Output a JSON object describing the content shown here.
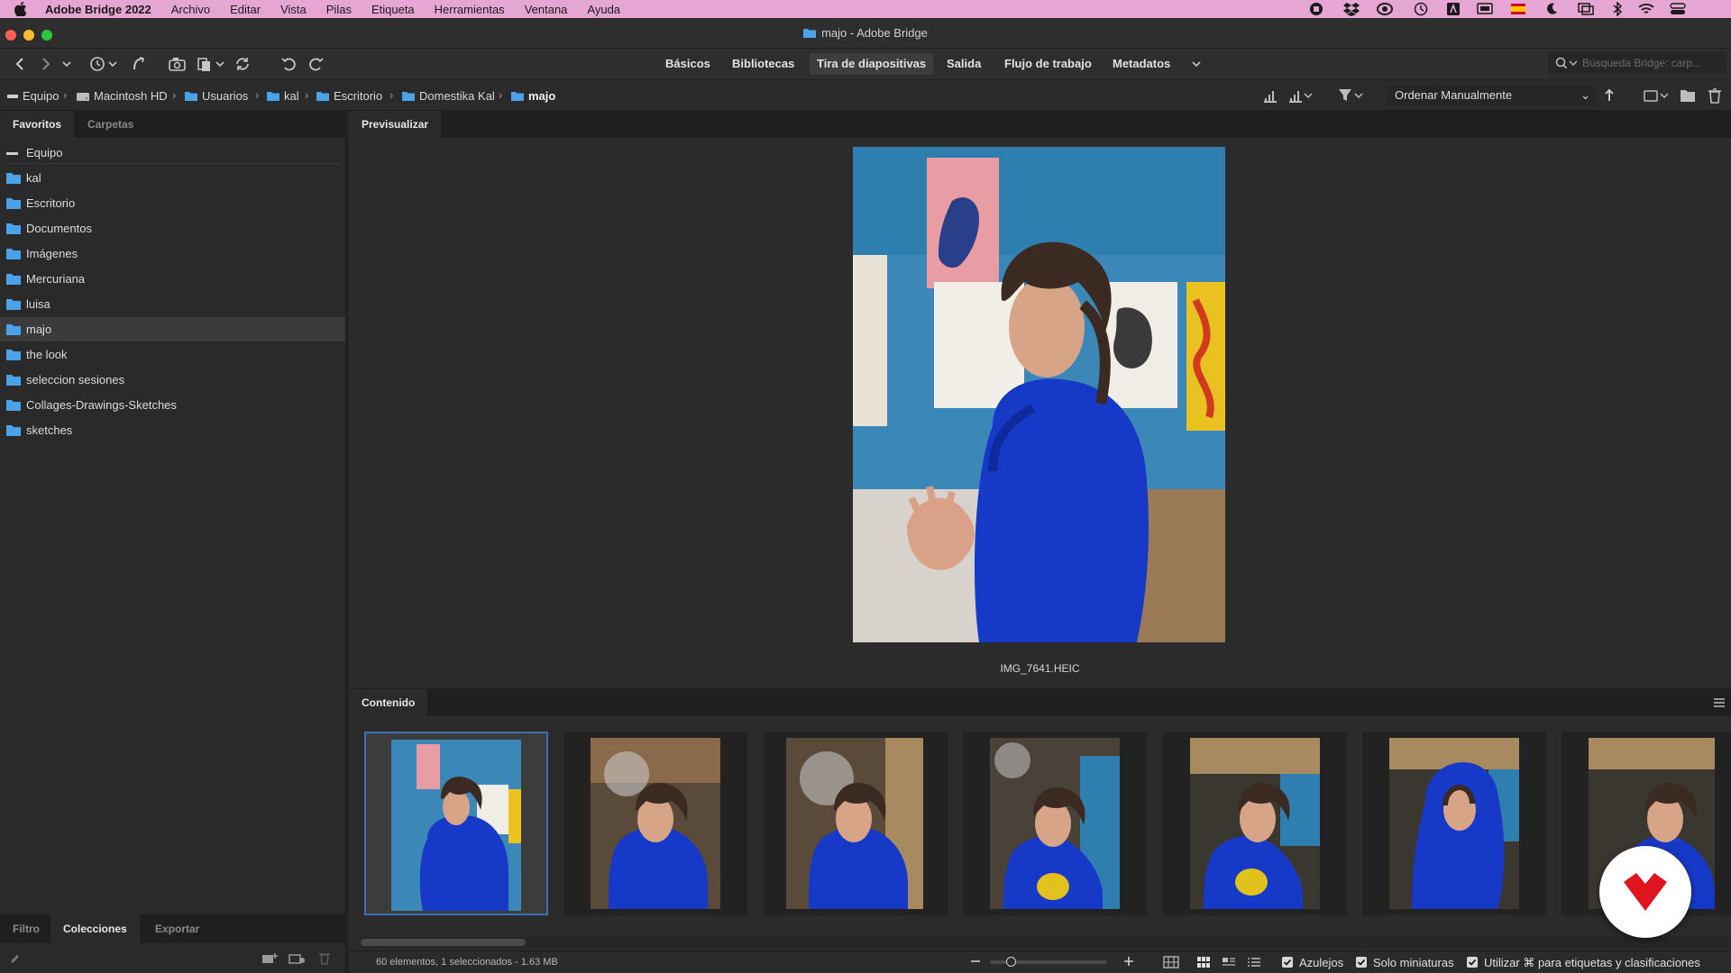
{
  "menubar": {
    "app_name": "Adobe Bridge 2022",
    "items": [
      "Archivo",
      "Editar",
      "Vista",
      "Pilas",
      "Etiqueta",
      "Herramientas",
      "Ventana",
      "Ayuda"
    ]
  },
  "window": {
    "title": "majo - Adobe Bridge"
  },
  "workspaces": [
    "Básicos",
    "Bibliotecas",
    "Tira de diapositivas",
    "Salida",
    "Flujo de trabajo",
    "Metadatos"
  ],
  "search": {
    "placeholder": "Búsqueda Bridge: carp..."
  },
  "path": [
    "Equipo",
    "Macintosh HD",
    "Usuarios",
    "kal",
    "Escritorio",
    "Domestika Kal",
    "majo"
  ],
  "sort": {
    "label": "Ordenar Manualmente"
  },
  "left_panel": {
    "tabs": [
      "Favoritos",
      "Carpetas"
    ],
    "favorites": [
      "Equipo",
      "kal",
      "Escritorio",
      "Documentos",
      "Imágenes",
      "Mercuriana",
      "luisa",
      "majo",
      "the look",
      "seleccion sesiones",
      "Collages-Drawings-Sketches",
      "sketches"
    ],
    "selected": "majo",
    "bottom_tabs": [
      "Filtro",
      "Colecciones",
      "Exportar"
    ]
  },
  "preview": {
    "tab": "Previsualizar",
    "filename": "IMG_7641.HEIC"
  },
  "content": {
    "tab": "Contenido",
    "thumbnail_count_visible": 7
  },
  "status": {
    "summary": "60 elementos, 1 seleccionados - 1.63 MB",
    "checkbox_tiles": "Azulejos",
    "checkbox_thumbs_only": "Solo miniaturas",
    "checkbox_cmd": "Utilizar ⌘ para etiquetas y clasificaciones"
  },
  "colors": {
    "menubar": "#e6a6d4",
    "selection_border": "#3f6fb5",
    "folder": "#4aa3e8",
    "badge": "#e0141e"
  }
}
